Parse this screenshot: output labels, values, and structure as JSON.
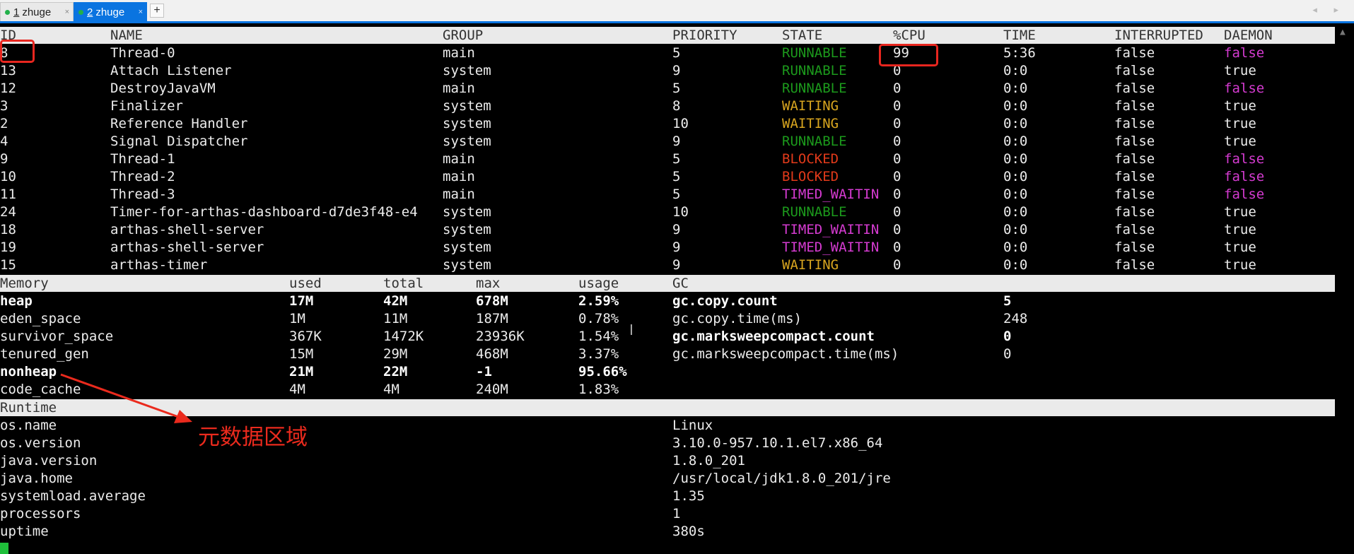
{
  "tabs": [
    {
      "num": "1",
      "label": "zhuge",
      "close": "×"
    },
    {
      "num": "2",
      "label": "zhuge",
      "close": "×"
    }
  ],
  "add_tab": "+",
  "nav_arrows": "◂ ▸",
  "threads": {
    "headers": [
      "ID",
      "NAME",
      "GROUP",
      "PRIORITY",
      "STATE",
      "%CPU",
      "TIME",
      "INTERRUPTED",
      "DAEMON"
    ],
    "rows": [
      {
        "id": "8",
        "name": "Thread-0",
        "group": "main",
        "priority": "5",
        "state": "RUNNABLE",
        "cpu": "99",
        "time": "5:36",
        "interrupted": "false",
        "daemon": "false"
      },
      {
        "id": "13",
        "name": "Attach Listener",
        "group": "system",
        "priority": "9",
        "state": "RUNNABLE",
        "cpu": "0",
        "time": "0:0",
        "interrupted": "false",
        "daemon": "true"
      },
      {
        "id": "12",
        "name": "DestroyJavaVM",
        "group": "main",
        "priority": "5",
        "state": "RUNNABLE",
        "cpu": "0",
        "time": "0:0",
        "interrupted": "false",
        "daemon": "false"
      },
      {
        "id": "3",
        "name": "Finalizer",
        "group": "system",
        "priority": "8",
        "state": "WAITING",
        "cpu": "0",
        "time": "0:0",
        "interrupted": "false",
        "daemon": "true"
      },
      {
        "id": "2",
        "name": "Reference Handler",
        "group": "system",
        "priority": "10",
        "state": "WAITING",
        "cpu": "0",
        "time": "0:0",
        "interrupted": "false",
        "daemon": "true"
      },
      {
        "id": "4",
        "name": "Signal Dispatcher",
        "group": "system",
        "priority": "9",
        "state": "RUNNABLE",
        "cpu": "0",
        "time": "0:0",
        "interrupted": "false",
        "daemon": "true"
      },
      {
        "id": "9",
        "name": "Thread-1",
        "group": "main",
        "priority": "5",
        "state": "BLOCKED",
        "cpu": "0",
        "time": "0:0",
        "interrupted": "false",
        "daemon": "false"
      },
      {
        "id": "10",
        "name": "Thread-2",
        "group": "main",
        "priority": "5",
        "state": "BLOCKED",
        "cpu": "0",
        "time": "0:0",
        "interrupted": "false",
        "daemon": "false"
      },
      {
        "id": "11",
        "name": "Thread-3",
        "group": "main",
        "priority": "5",
        "state": "TIMED_WAITIN",
        "cpu": "0",
        "time": "0:0",
        "interrupted": "false",
        "daemon": "false"
      },
      {
        "id": "24",
        "name": "Timer-for-arthas-dashboard-d7de3f48-e4",
        "group": "system",
        "priority": "10",
        "state": "RUNNABLE",
        "cpu": "0",
        "time": "0:0",
        "interrupted": "false",
        "daemon": "true"
      },
      {
        "id": "18",
        "name": "arthas-shell-server",
        "group": "system",
        "priority": "9",
        "state": "TIMED_WAITIN",
        "cpu": "0",
        "time": "0:0",
        "interrupted": "false",
        "daemon": "true"
      },
      {
        "id": "19",
        "name": "arthas-shell-server",
        "group": "system",
        "priority": "9",
        "state": "TIMED_WAITIN",
        "cpu": "0",
        "time": "0:0",
        "interrupted": "false",
        "daemon": "true"
      },
      {
        "id": "15",
        "name": "arthas-timer",
        "group": "system",
        "priority": "9",
        "state": "WAITING",
        "cpu": "0",
        "time": "0:0",
        "interrupted": "false",
        "daemon": "true"
      }
    ]
  },
  "memory": {
    "headers": [
      "Memory",
      "used",
      "total",
      "max",
      "usage",
      "GC"
    ],
    "rows": [
      {
        "name": "heap",
        "used": "17M",
        "total": "42M",
        "max": "678M",
        "usage": "2.59%",
        "gc_name": "gc.copy.count",
        "gc_value": "5",
        "bold": true
      },
      {
        "name": "eden_space",
        "used": "1M",
        "total": "11M",
        "max": "187M",
        "usage": "0.78%",
        "gc_name": "gc.copy.time(ms)",
        "gc_value": "248",
        "bold": false
      },
      {
        "name": "survivor_space",
        "used": "367K",
        "total": "1472K",
        "max": "23936K",
        "usage": "1.54%",
        "gc_name": "gc.marksweepcompact.count",
        "gc_value": "0",
        "bold": false,
        "gc_bold": true
      },
      {
        "name": "tenured_gen",
        "used": "15M",
        "total": "29M",
        "max": "468M",
        "usage": "3.37%",
        "gc_name": "gc.marksweepcompact.time(ms)",
        "gc_value": "0",
        "bold": false
      },
      {
        "name": "nonheap",
        "used": "21M",
        "total": "22M",
        "max": "-1",
        "usage": "95.66%",
        "gc_name": "",
        "gc_value": "",
        "bold": true
      },
      {
        "name": "code_cache",
        "used": "4M",
        "total": "4M",
        "max": "240M",
        "usage": "1.83%",
        "gc_name": "",
        "gc_value": "",
        "bold": false
      }
    ]
  },
  "runtime": {
    "header": "Runtime",
    "rows": [
      {
        "key": "os.name",
        "value": "Linux"
      },
      {
        "key": "os.version",
        "value": "3.10.0-957.10.1.el7.x86_64"
      },
      {
        "key": "java.version",
        "value": "1.8.0_201"
      },
      {
        "key": "java.home",
        "value": "/usr/local/jdk1.8.0_201/jre"
      },
      {
        "key": "systemload.average",
        "value": "1.35"
      },
      {
        "key": "processors",
        "value": "1"
      },
      {
        "key": "uptime",
        "value": "380s"
      }
    ]
  },
  "annotation": {
    "text": "元数据区域",
    "color": "#ea2a1d"
  },
  "colors": {
    "tab_active": "#0a74e0",
    "runnable": "#1c9a1c",
    "waiting": "#d8a51f",
    "blocked": "#e23a1a",
    "timed_waiting": "#d53bd1",
    "daemon_false": "#d53bd1",
    "header_bg": "#eaeaea",
    "highlight_box": "#e8261f",
    "cursor": "#1fbf3a"
  },
  "icons": {
    "tab_status": "green-dot-icon",
    "close": "close-icon",
    "add": "plus-icon",
    "scroll": "scroll-up-arrow-icon"
  }
}
